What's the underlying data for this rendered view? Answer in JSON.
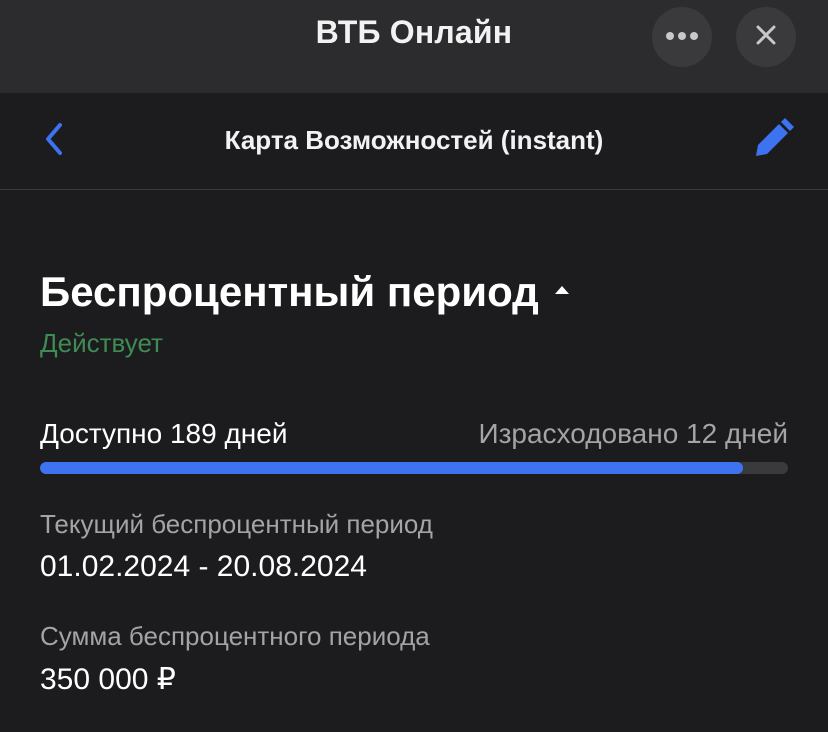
{
  "app": {
    "title": "ВТБ Онлайн"
  },
  "nav": {
    "title": "Карта Возможностей (instant)"
  },
  "section": {
    "title": "Беспроцентный период",
    "status": "Действует"
  },
  "period": {
    "available_label": "Доступно 189 дней",
    "spent_label": "Израсходовано 12 дней",
    "available_fraction": 0.94
  },
  "fields": [
    {
      "label": "Текущий беспроцентный период",
      "value": "01.02.2024 - 20.08.2024"
    },
    {
      "label": "Сумма беспроцентного периода",
      "value": "350 000 ₽"
    }
  ],
  "colors": {
    "accent": "#3d73f0",
    "status": "#3f8b54",
    "background": "#1c1c1e",
    "top_bar": "#2c2c2e"
  },
  "icons": {
    "more": "more-icon",
    "close": "close-icon",
    "back": "chevron-left-icon",
    "edit": "pencil-icon",
    "collapse": "caret-up-icon"
  }
}
